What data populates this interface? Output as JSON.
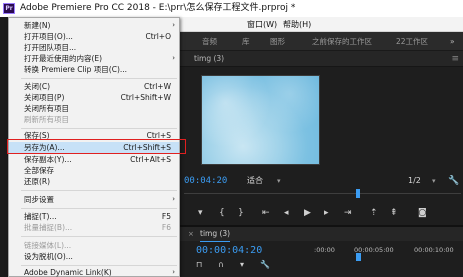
{
  "title_bar": {
    "app_icon": "premiere-pro-logo",
    "app_icon_text": "Pr",
    "text": "Adobe Premiere Pro CC 2018 - E:\\prr\\怎么保存工程文件.prproj *"
  },
  "menu_bar": {
    "items": [
      "窗口(W)",
      "帮助(H)"
    ]
  },
  "workspace_bar": {
    "items": [
      "音频",
      "库",
      "图形",
      "之前保存的工作区",
      "22工作区"
    ],
    "more_icon": "chevron-double-right-icon"
  },
  "program_monitor": {
    "tab_label": "timg (3)",
    "menu_icon": "panel-menu-icon",
    "timecode": "00:04:20",
    "fit_label": "适合",
    "resolution": "1/2",
    "settings_icon": "wrench-icon",
    "transport_icons": [
      "marker-icon",
      "in-point-icon",
      "out-point-icon",
      "go-to-in-icon",
      "step-back-icon",
      "play-icon",
      "step-forward-icon",
      "go-to-out-icon",
      "lift-icon",
      "extract-icon",
      "export-frame-icon"
    ]
  },
  "timeline": {
    "close_icon": "close-icon",
    "tab_label": "timg (3)",
    "timecode": "00:00:04:20",
    "ruler": [
      ":00:00",
      "00:00:05:00",
      "00:00:10:00"
    ],
    "tool_icons": [
      "snap-icon",
      "linked-icon",
      "marker-icon",
      "wrench-icon"
    ]
  },
  "file_menu": {
    "items": [
      {
        "label": "新建(N)",
        "shortcut": "",
        "submenu": true,
        "disabled": false
      },
      {
        "label": "打开项目(O)...",
        "shortcut": "Ctrl+O",
        "submenu": false,
        "disabled": false
      },
      {
        "label": "打开团队项目...",
        "shortcut": "",
        "submenu": false,
        "disabled": false
      },
      {
        "label": "打开最近使用的内容(E)",
        "shortcut": "",
        "submenu": true,
        "disabled": false
      },
      {
        "label": "转换 Premiere Clip 项目(C)...",
        "shortcut": "",
        "submenu": false,
        "disabled": false
      },
      {
        "label": "关闭(C)",
        "shortcut": "Ctrl+W",
        "submenu": false,
        "disabled": false
      },
      {
        "label": "关闭项目(P)",
        "shortcut": "Ctrl+Shift+W",
        "submenu": false,
        "disabled": false
      },
      {
        "label": "关闭所有项目",
        "shortcut": "",
        "submenu": false,
        "disabled": false
      },
      {
        "label": "刷新所有项目",
        "shortcut": "",
        "submenu": false,
        "disabled": true
      },
      {
        "label": "保存(S)",
        "shortcut": "Ctrl+S",
        "submenu": false,
        "disabled": false
      },
      {
        "label": "另存为(A)...",
        "shortcut": "Ctrl+Shift+S",
        "submenu": false,
        "disabled": false,
        "highlighted": true
      },
      {
        "label": "保存副本(Y)...",
        "shortcut": "Ctrl+Alt+S",
        "submenu": false,
        "disabled": false
      },
      {
        "label": "全部保存",
        "shortcut": "",
        "submenu": false,
        "disabled": false
      },
      {
        "label": "还原(R)",
        "shortcut": "",
        "submenu": false,
        "disabled": false
      },
      {
        "label": "同步设置",
        "shortcut": "",
        "submenu": true,
        "disabled": false
      },
      {
        "label": "捕捉(T)...",
        "shortcut": "F5",
        "submenu": false,
        "disabled": false
      },
      {
        "label": "批量捕捉(B)...",
        "shortcut": "F6",
        "submenu": false,
        "disabled": true
      },
      {
        "label": "链接媒体(L)...",
        "shortcut": "",
        "submenu": false,
        "disabled": true
      },
      {
        "label": "设为脱机(O)...",
        "shortcut": "",
        "submenu": false,
        "disabled": false
      },
      {
        "label": "Adobe Dynamic Link(K)",
        "shortcut": "",
        "submenu": true,
        "disabled": false
      }
    ]
  },
  "colors": {
    "accent_blue": "#3b9cf2",
    "highlight": "#c7e1f7",
    "annotation_red": "#e02020"
  }
}
